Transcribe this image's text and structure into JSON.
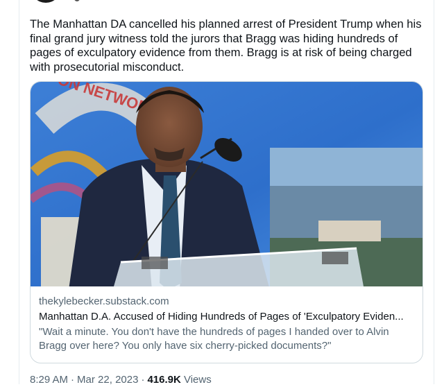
{
  "tweet": {
    "text": "The Manhattan DA cancelled his planned arrest of President Trump when his final grand jury witness told the jurors that Bragg was hiding hundreds of pages of exculpatory evidence from them. Bragg is at risk of being charged with prosecutorial misconduct."
  },
  "card": {
    "domain": "thekylebecker.substack.com",
    "title": "Manhattan D.A. Accused of Hiding Hundreds of Pages of 'Exculpatory Eviden...",
    "description": "\"Wait a minute. You don't have the hundreds of pages I handed over to Alvin Bragg over here? You only have six cherry-picked documents?\"",
    "image_banner_text": "ON NETWORK"
  },
  "meta": {
    "time": "8:29 AM",
    "separator": "·",
    "date": "Mar 22, 2023",
    "views_count": "416.9K",
    "views_label": "Views"
  },
  "colors": {
    "text_primary": "#0f1419",
    "text_secondary": "#536471",
    "border": "#cfd9de"
  }
}
